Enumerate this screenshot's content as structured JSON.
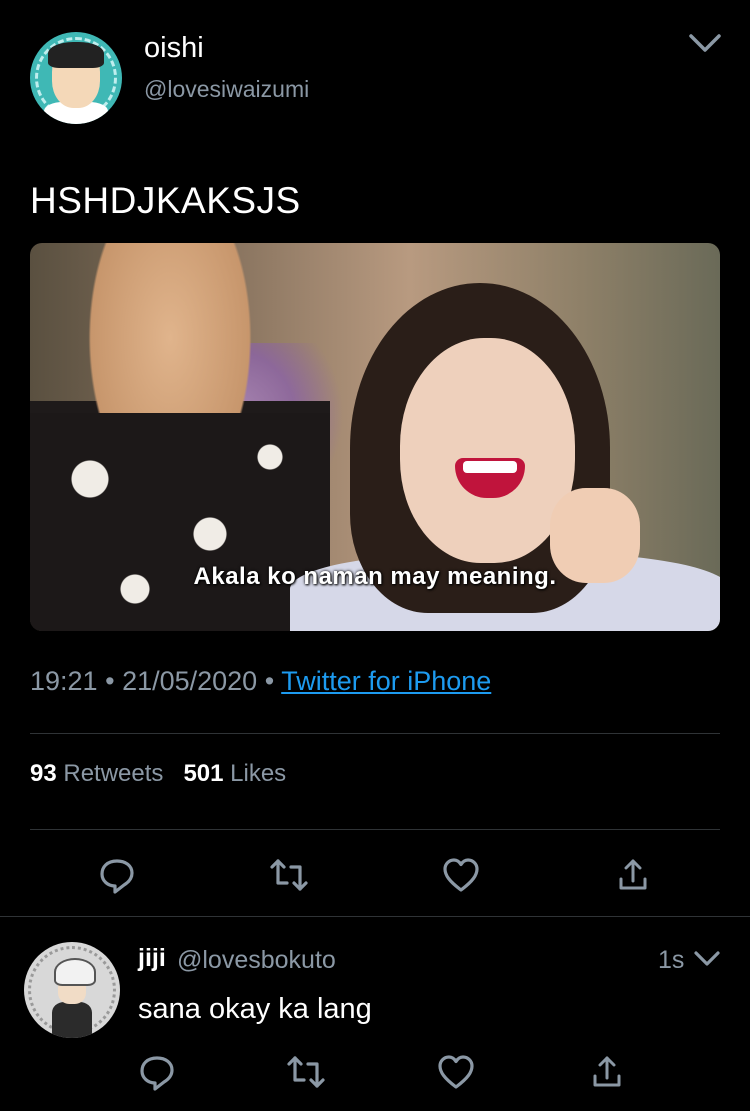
{
  "tweet": {
    "display_name": "oishi",
    "handle": "@lovesiwaizumi",
    "text": "HSHDJKAKSJS",
    "media": {
      "subtitle": "Akala ko naman may meaning."
    },
    "time": "19:21",
    "separator": "•",
    "date": "21/05/2020",
    "source": "Twitter for iPhone",
    "stats": {
      "retweets_count": "93",
      "retweets_label": "Retweets",
      "likes_count": "501",
      "likes_label": "Likes"
    }
  },
  "reply": {
    "display_name": "jiji",
    "handle": "@lovesbokuto",
    "time": "1s",
    "text": "sana okay ka lang"
  },
  "icons": {
    "reply": "reply-icon",
    "retweet": "retweet-icon",
    "like": "heart-icon",
    "share": "share-icon",
    "more": "chevron-down-icon"
  },
  "colors": {
    "background": "#000000",
    "text": "#ffffff",
    "muted": "#8b98a5",
    "link": "#1d9bf0",
    "divider": "#2f3336"
  }
}
